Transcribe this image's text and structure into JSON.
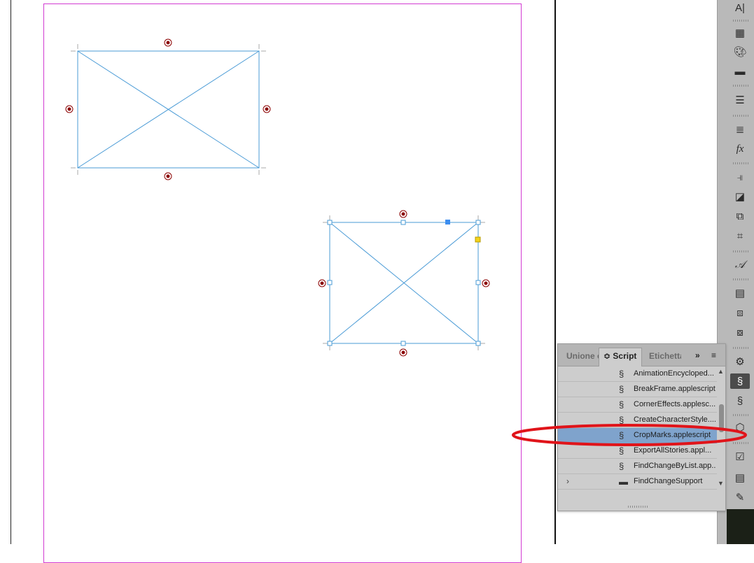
{
  "panel": {
    "tabs": [
      {
        "label": "Unione c"
      },
      {
        "label": "Script",
        "prefix": "≎",
        "active": true
      },
      {
        "label": "Etichetta"
      }
    ],
    "more_label": "»",
    "menu_icon": "panel-menu-icon",
    "items": [
      {
        "label": "AnimationEncycloped...",
        "icon": "script-icon"
      },
      {
        "label": "BreakFrame.applescript",
        "icon": "script-icon"
      },
      {
        "label": "CornerEffects.applesc...",
        "icon": "script-icon"
      },
      {
        "label": "CreateCharacterStyle....",
        "icon": "script-icon"
      },
      {
        "label": "CropMarks.applescript",
        "icon": "script-icon",
        "selected": true
      },
      {
        "label": "ExportAllStories.appl...",
        "icon": "script-icon"
      },
      {
        "label": "FindChangeByList.app...",
        "icon": "script-icon"
      },
      {
        "label": "FindChangeSupport",
        "icon": "folder-icon",
        "expander": "›"
      }
    ]
  },
  "tools": [
    "character-icon",
    "swatches-icon",
    "color-icon",
    "gradient-icon",
    "stroke-icon",
    "paragraph-icon",
    "effects-icon",
    "align-icon",
    "pathfinder-icon",
    "transform-icon",
    "bounding-icon",
    "glyphs-icon",
    "table-icon",
    "pages-icon",
    "layers-icon",
    "scripts-gear-icon",
    "scripts-icon",
    "script-label-icon",
    "data-merge-icon",
    "preflight-icon",
    "notes-icon",
    "assignments-icon"
  ],
  "colors": {
    "frame_stroke": "#4a9bd6",
    "margin_guide": "#d23bd2",
    "selection_highlight": "#7fa3cc",
    "annotation_red": "#e0141a"
  }
}
